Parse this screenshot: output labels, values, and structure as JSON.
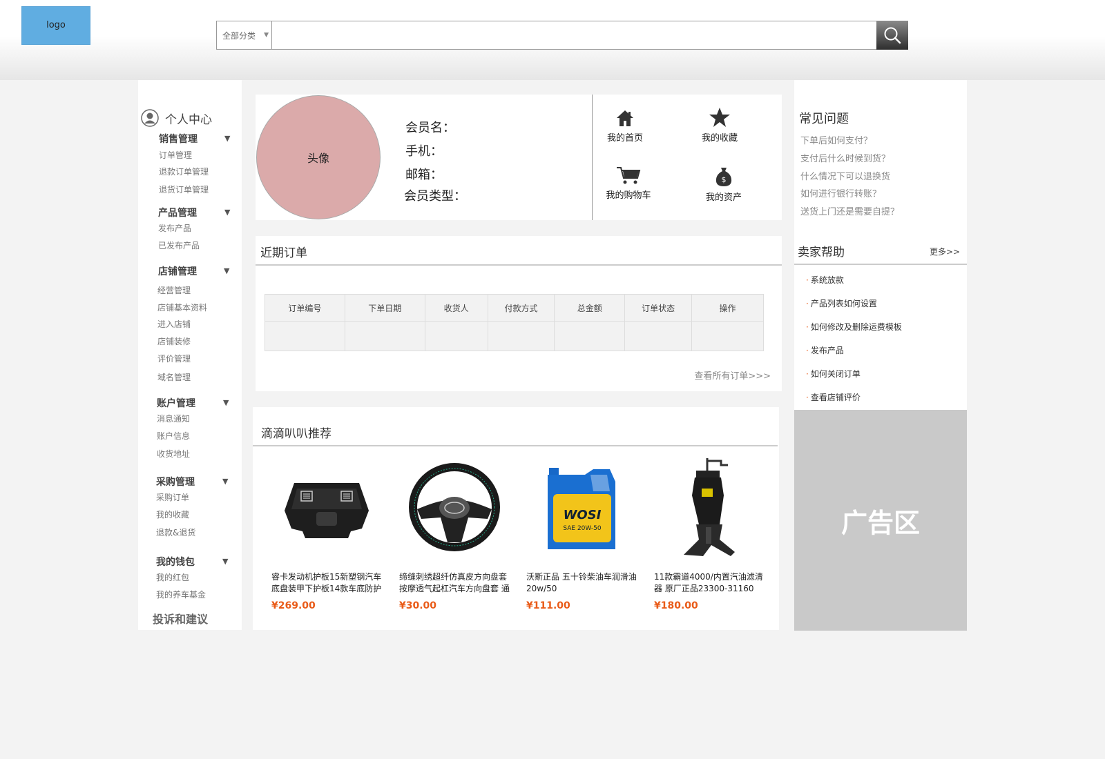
{
  "header": {
    "logo_text": "logo",
    "search": {
      "category": "全部分类",
      "placeholder": ""
    }
  },
  "sidebar": {
    "personal_center": "个人中心",
    "groups": [
      {
        "title": "销售管理",
        "items": [
          "订单管理",
          "退款订单管理",
          "退货订单管理"
        ]
      },
      {
        "title": "产品管理",
        "items": [
          "发布产品",
          "已发布产品"
        ]
      },
      {
        "title": "店铺管理",
        "items": [
          "经营管理",
          "店铺基本资料",
          "进入店铺",
          "店铺装修",
          "评价管理",
          "域名管理"
        ]
      },
      {
        "title": "账户管理",
        "items": [
          "消息通知",
          "账户信息",
          "收货地址"
        ]
      },
      {
        "title": "采购管理",
        "items": [
          "采购订单",
          "我的收藏",
          "退款&退货"
        ]
      },
      {
        "title": "我的钱包",
        "items": [
          "我的红包",
          "我的养车基金"
        ]
      }
    ],
    "complaint": "投诉和建议"
  },
  "profile": {
    "avatar_label": "头像",
    "member_name": "会员名：",
    "phone": "手机：",
    "email": "邮箱：",
    "member_type": "会员类型：",
    "links": {
      "home": "我的首页",
      "favorites": "我的收藏",
      "cart": "我的购物车",
      "assets": "我的资产"
    }
  },
  "orders": {
    "title": "近期订单",
    "columns": [
      "订单编号",
      "下单日期",
      "收货人",
      "付款方式",
      "总金额",
      "订单状态",
      "操作"
    ],
    "view_all": "查看所有订单>>>"
  },
  "recommend": {
    "title": "滴滴叭叭推荐",
    "products": [
      {
        "name": "睿卡发动机护板15新塑钢汽车底盘装甲下护板14款车底防护",
        "price": "¥269.00",
        "icon": "engine-guard-icon"
      },
      {
        "name": "缔缝刺绣超纤仿真皮方向盘套按摩透气起杠汽车方向盘套 通",
        "price": "¥30.00",
        "icon": "steering-wheel-icon"
      },
      {
        "name": "沃斯正品 五十铃柴油车润滑油20w/50",
        "price": "¥111.00",
        "icon": "oil-bottle-icon"
      },
      {
        "name": "11款霸道4000/内置汽油滤清器 原厂正品23300-31160",
        "price": "¥180.00",
        "icon": "fuel-filter-icon"
      }
    ]
  },
  "faq": {
    "title": "常见问题",
    "items": [
      "下单后如何支付？",
      "支付后什么时候到货？",
      "什么情况下可以退换货",
      "如何进行银行转账？",
      "送货上门还是需要自提？"
    ]
  },
  "seller_help": {
    "title": "卖家帮助",
    "more": "更多>>",
    "items": [
      "系统放款",
      "产品列表如何设置",
      "如何修改及删除运费模板",
      "发布产品",
      "如何关闭订单",
      "查看店铺评价"
    ]
  },
  "ad": {
    "label": "广告区"
  },
  "colors": {
    "logo": "#60ade1",
    "price": "#e95b18",
    "avatar": "#dbaaaa",
    "ad": "#c9c9c9"
  }
}
